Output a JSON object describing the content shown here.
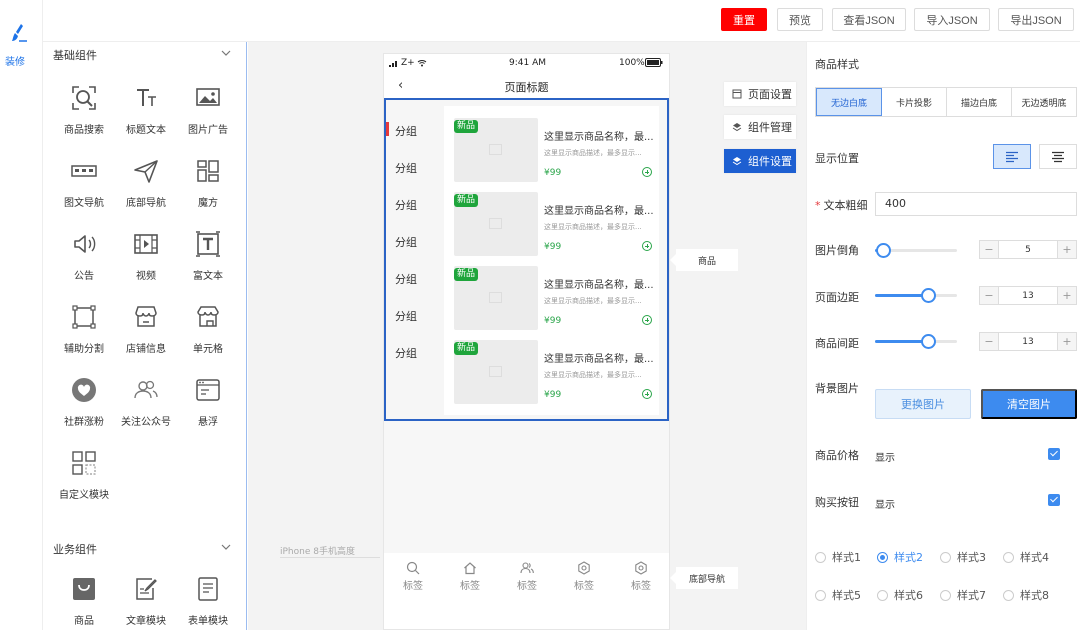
{
  "colors": {
    "accent": "#1d5fd1",
    "danger": "#ff0000",
    "price_green": "#2aa54a",
    "new_tag": "#1fa53c"
  },
  "toolbar": {
    "reset": "重置",
    "preview": "预览",
    "view_json": "查看JSON",
    "import_json": "导入JSON",
    "export_json": "导出JSON"
  },
  "rail": {
    "decorate_label": "装修",
    "icon": "brush-icon"
  },
  "panel": {
    "basic_title": "基础组件",
    "basic": [
      "商品搜索",
      "标题文本",
      "图片广告",
      "图文导航",
      "底部导航",
      "魔方",
      "公告",
      "视频",
      "富文本",
      "辅助分割",
      "店铺信息",
      "单元格",
      "社群涨粉",
      "关注公众号",
      "悬浮",
      "自定义模块"
    ],
    "business_title": "业务组件",
    "business": [
      "商品",
      "文章模块",
      "表单模块"
    ]
  },
  "phone": {
    "status_carrier": "Z+",
    "status_time": "9:41 AM",
    "status_battery": "100%",
    "title": "页面标题",
    "back": "‹",
    "groups": [
      "分组",
      "分组",
      "分组",
      "分组",
      "分组",
      "分组",
      "分组"
    ],
    "goods": [
      {
        "tag": "新品",
        "name": "这里显示商品名称，最...",
        "desc": "这里显示商品描述，最多显示...",
        "price": "¥99"
      },
      {
        "tag": "新品",
        "name": "这里显示商品名称，最...",
        "desc": "这里显示商品描述，最多显示...",
        "price": "¥99"
      },
      {
        "tag": "新品",
        "name": "这里显示商品名称，最...",
        "desc": "这里显示商品描述，最多显示...",
        "price": "¥99"
      },
      {
        "tag": "新品",
        "name": "这里显示商品名称，最...",
        "desc": "这里显示商品描述，最多显示...",
        "price": "¥99"
      }
    ],
    "tabs": [
      "标签",
      "标签",
      "标签",
      "标签",
      "标签"
    ],
    "device_label": "iPhone 8手机高度"
  },
  "canvas": {
    "page_settings": "页面设置",
    "component_manage": "组件管理",
    "component_settings": "组件设置",
    "goods_label": "商品",
    "bottom_nav_label": "底部导航"
  },
  "props": {
    "style_label": "商品样式",
    "styles": [
      "无边白底",
      "卡片投影",
      "描边白底",
      "无边透明底"
    ],
    "position_label": "显示位置",
    "font_weight_label": "文本粗细",
    "font_weight_value": "400",
    "radius_label": "图片倒角",
    "radius_value": "5",
    "radius_fraction": 0.1,
    "margin_label": "页面边距",
    "margin_value": "13",
    "margin_fraction": 0.65,
    "gap_label": "商品间距",
    "gap_value": "13",
    "gap_fraction": 0.65,
    "bg_label": "背景图片",
    "change_image": "更换图片",
    "clear_image": "清空图片",
    "price_label": "商品价格",
    "price_value": "显示",
    "buy_label": "购买按钮",
    "buy_value": "显示",
    "button_styles": [
      "样式1",
      "样式2",
      "样式3",
      "样式4",
      "样式5",
      "样式6",
      "样式7",
      "样式8"
    ],
    "minus": "−",
    "plus": "+"
  }
}
